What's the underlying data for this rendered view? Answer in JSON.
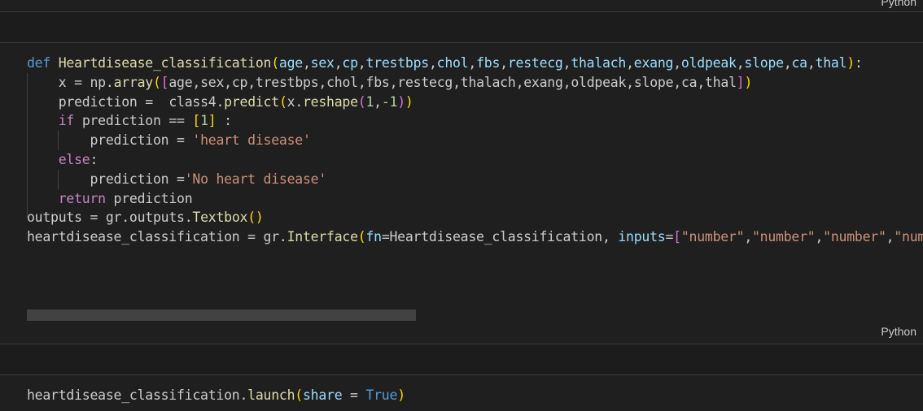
{
  "cells": [
    {
      "language_label": "Python"
    },
    {
      "language_label": "Python",
      "lines": [
        [
          [
            "kw",
            "def"
          ],
          [
            "op",
            " "
          ],
          [
            "fn",
            "Heartdisease_classification"
          ],
          [
            "b1",
            "("
          ],
          [
            "par",
            "age"
          ],
          [
            "op",
            ","
          ],
          [
            "par",
            "sex"
          ],
          [
            "op",
            ","
          ],
          [
            "par",
            "cp"
          ],
          [
            "op",
            ","
          ],
          [
            "par",
            "trestbps"
          ],
          [
            "op",
            ","
          ],
          [
            "par",
            "chol"
          ],
          [
            "op",
            ","
          ],
          [
            "par",
            "fbs"
          ],
          [
            "op",
            ","
          ],
          [
            "par",
            "restecg"
          ],
          [
            "op",
            ","
          ],
          [
            "par",
            "thalach"
          ],
          [
            "op",
            ","
          ],
          [
            "par",
            "exang"
          ],
          [
            "op",
            ","
          ],
          [
            "par",
            "oldpeak"
          ],
          [
            "op",
            ","
          ],
          [
            "par",
            "slope"
          ],
          [
            "op",
            ","
          ],
          [
            "par",
            "ca"
          ],
          [
            "op",
            ","
          ],
          [
            "par",
            "thal"
          ],
          [
            "b1",
            ")"
          ],
          [
            "op",
            ":"
          ]
        ],
        [
          [
            "op",
            "    "
          ],
          [
            "var",
            "x"
          ],
          [
            "op",
            " = "
          ],
          [
            "var",
            "np"
          ],
          [
            "op",
            "."
          ],
          [
            "fn",
            "array"
          ],
          [
            "b1",
            "("
          ],
          [
            "b2",
            "["
          ],
          [
            "var",
            "age"
          ],
          [
            "op",
            ","
          ],
          [
            "var",
            "sex"
          ],
          [
            "op",
            ","
          ],
          [
            "var",
            "cp"
          ],
          [
            "op",
            ","
          ],
          [
            "var",
            "trestbps"
          ],
          [
            "op",
            ","
          ],
          [
            "var",
            "chol"
          ],
          [
            "op",
            ","
          ],
          [
            "var",
            "fbs"
          ],
          [
            "op",
            ","
          ],
          [
            "var",
            "restecg"
          ],
          [
            "op",
            ","
          ],
          [
            "var",
            "thalach"
          ],
          [
            "op",
            ","
          ],
          [
            "var",
            "exang"
          ],
          [
            "op",
            ","
          ],
          [
            "var",
            "oldpeak"
          ],
          [
            "op",
            ","
          ],
          [
            "var",
            "slope"
          ],
          [
            "op",
            ","
          ],
          [
            "var",
            "ca"
          ],
          [
            "op",
            ","
          ],
          [
            "var",
            "thal"
          ],
          [
            "b2",
            "]"
          ],
          [
            "b1",
            ")"
          ]
        ],
        [
          [
            "op",
            "    "
          ],
          [
            "var",
            "prediction"
          ],
          [
            "op",
            " =  "
          ],
          [
            "var",
            "class4"
          ],
          [
            "op",
            "."
          ],
          [
            "fn",
            "predict"
          ],
          [
            "b1",
            "("
          ],
          [
            "var",
            "x"
          ],
          [
            "op",
            "."
          ],
          [
            "fn",
            "reshape"
          ],
          [
            "b2",
            "("
          ],
          [
            "num",
            "1"
          ],
          [
            "op",
            ","
          ],
          [
            "num",
            "-1"
          ],
          [
            "b2",
            ")"
          ],
          [
            "b1",
            ")"
          ]
        ],
        [
          [
            "op",
            "    "
          ],
          [
            "ctl",
            "if"
          ],
          [
            "op",
            " "
          ],
          [
            "var",
            "prediction"
          ],
          [
            "op",
            " == "
          ],
          [
            "b1",
            "["
          ],
          [
            "num",
            "1"
          ],
          [
            "b1",
            "]"
          ],
          [
            "op",
            " :"
          ]
        ],
        [
          [
            "op",
            "        "
          ],
          [
            "var",
            "prediction"
          ],
          [
            "op",
            " = "
          ],
          [
            "str",
            "'heart disease'"
          ]
        ],
        [
          [
            "op",
            "    "
          ],
          [
            "ctl",
            "else"
          ],
          [
            "op",
            ":"
          ]
        ],
        [
          [
            "op",
            "        "
          ],
          [
            "var",
            "prediction"
          ],
          [
            "op",
            " ="
          ],
          [
            "str",
            "'No heart disease'"
          ]
        ],
        [
          [
            "op",
            "    "
          ],
          [
            "ctl",
            "return"
          ],
          [
            "op",
            " "
          ],
          [
            "var",
            "prediction"
          ]
        ],
        [
          [
            "var",
            "outputs"
          ],
          [
            "op",
            " = "
          ],
          [
            "var",
            "gr"
          ],
          [
            "op",
            "."
          ],
          [
            "var",
            "outputs"
          ],
          [
            "op",
            "."
          ],
          [
            "fn",
            "Textbox"
          ],
          [
            "b1",
            "("
          ],
          [
            "b1",
            ")"
          ]
        ],
        [
          [
            "var",
            "heartdisease_classification"
          ],
          [
            "op",
            " = "
          ],
          [
            "var",
            "gr"
          ],
          [
            "op",
            "."
          ],
          [
            "fn",
            "Interface"
          ],
          [
            "b1",
            "("
          ],
          [
            "par",
            "fn"
          ],
          [
            "op",
            "="
          ],
          [
            "var",
            "Heartdisease_classification"
          ],
          [
            "op",
            ", "
          ],
          [
            "par",
            "inputs"
          ],
          [
            "op",
            "="
          ],
          [
            "b2",
            "["
          ],
          [
            "str",
            "\"number\""
          ],
          [
            "op",
            ","
          ],
          [
            "str",
            "\"number\""
          ],
          [
            "op",
            ","
          ],
          [
            "str",
            "\"number\""
          ],
          [
            "op",
            ","
          ],
          [
            "str",
            "\"numb"
          ]
        ]
      ]
    },
    {
      "lines": [
        [
          [
            "var",
            "heartdisease_classification"
          ],
          [
            "op",
            "."
          ],
          [
            "fn",
            "launch"
          ],
          [
            "b1",
            "("
          ],
          [
            "par",
            "share"
          ],
          [
            "op",
            " = "
          ],
          [
            "kw",
            "True"
          ],
          [
            "b1",
            ")"
          ]
        ]
      ]
    }
  ]
}
